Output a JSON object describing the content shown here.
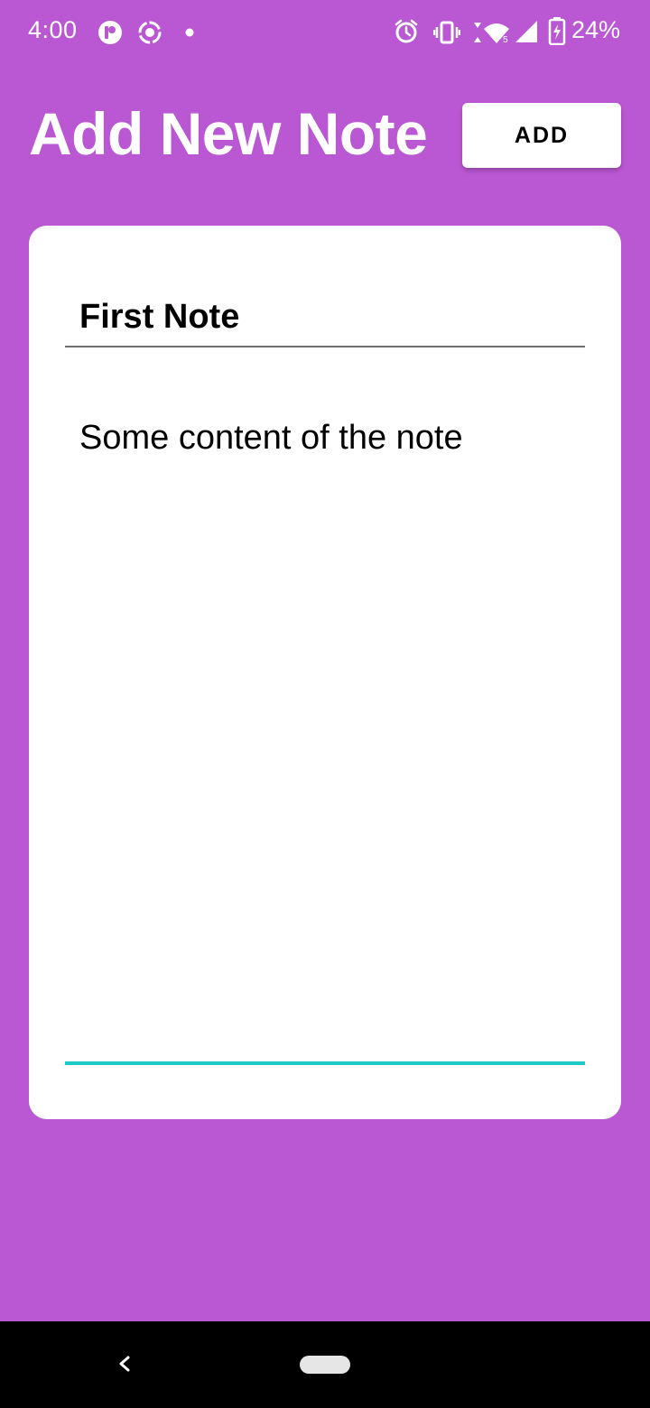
{
  "status_bar": {
    "time": "4:00",
    "battery": "24%",
    "icons": [
      "app-notification-icon",
      "screen-record-icon",
      "dot-icon",
      "alarm-icon",
      "vibrate-icon",
      "wifi-icon",
      "cell-signal-icon",
      "battery-charging-icon"
    ]
  },
  "header": {
    "title": "Add New Note",
    "add_label": "ADD"
  },
  "note": {
    "title": "First Note",
    "content": "Some content of the note"
  },
  "nav_bar": {
    "icons": [
      "back-icon",
      "home-pill-icon"
    ]
  },
  "colors": {
    "background": "#BA57D3",
    "card": "#FFFFFF",
    "focus_underline": "#1FC9C4",
    "nav_bar": "#000000"
  }
}
